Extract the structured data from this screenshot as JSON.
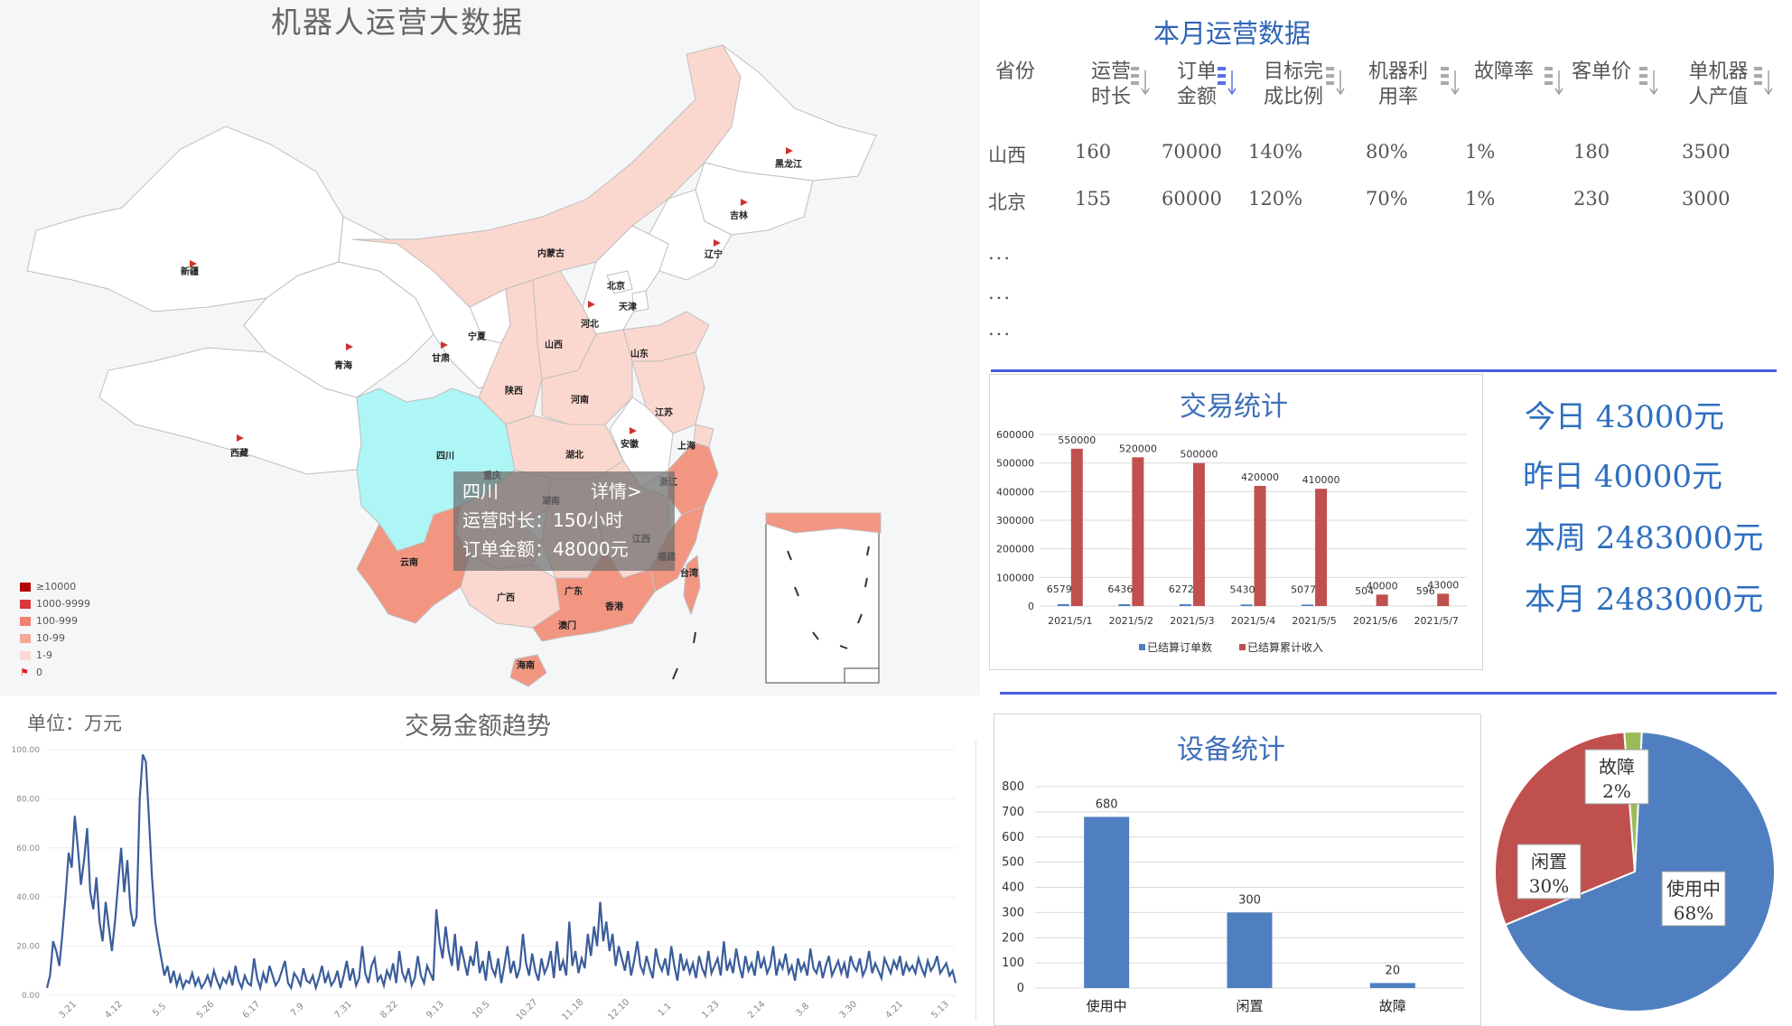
{
  "map": {
    "title": "机器人运营大数据",
    "provinces": [
      "黑龙江",
      "吉林",
      "辽宁",
      "内蒙古",
      "北京",
      "天津",
      "河北",
      "山西",
      "宁夏",
      "甘肃",
      "青海",
      "新疆",
      "西藏",
      "四川",
      "陕西",
      "河南",
      "山东",
      "江苏",
      "安徽",
      "湖北",
      "上海",
      "浙江",
      "重庆",
      "湖南",
      "江西",
      "福建",
      "云南",
      "广西",
      "广东",
      "香港",
      "澳门",
      "海南",
      "台湾"
    ],
    "tooltip": {
      "name": "四川",
      "detail": "详情>",
      "line1": "运营时长：150小时",
      "line2": "订单金额：48000元"
    },
    "legend": [
      {
        "label": "≥10000",
        "color": "#b00000"
      },
      {
        "label": "1000-9999",
        "color": "#d9363e"
      },
      {
        "label": "100-999",
        "color": "#f08070"
      },
      {
        "label": "10-99",
        "color": "#f4a898"
      },
      {
        "label": "1-9",
        "color": "#fbd9d2"
      },
      {
        "label": "0",
        "color": "#e02020"
      }
    ],
    "colors": {
      "sichuan": "#aef5f5",
      "dark": "#f29682",
      "mid": "#f6b8aa",
      "light": "#fbd8cf",
      "white": "#ffffff"
    }
  },
  "ops_table": {
    "title": "本月运营数据",
    "headers": [
      {
        "line1": "省份",
        "line2": ""
      },
      {
        "line1": "运营",
        "line2": "时长"
      },
      {
        "line1": "订单",
        "line2": "金额"
      },
      {
        "line1": "目标完",
        "line2": "成比例"
      },
      {
        "line1": "机器利",
        "line2": "用率"
      },
      {
        "line1": "故障率",
        "line2": ""
      },
      {
        "line1": "客单价",
        "line2": ""
      },
      {
        "line1": "单机器",
        "line2": "人产值"
      }
    ],
    "rows": [
      [
        "山西",
        "160",
        "70000",
        "140%",
        "80%",
        "1%",
        "180",
        "3500"
      ],
      [
        "北京",
        "155",
        "60000",
        "120%",
        "70%",
        "1%",
        "230",
        "3000"
      ]
    ],
    "ellipsis": [
      "...",
      "...",
      "..."
    ]
  },
  "trade_stats": {
    "title": "交易统计",
    "today": "今日 43000元",
    "yesterday": "昨日 40000元",
    "week": "本周 2483000元",
    "month": "本月 2483000元"
  },
  "device_stats": {
    "title": "设备统计"
  },
  "trend": {
    "title": "交易金额趋势",
    "unit": "单位：万元"
  },
  "chart_data": [
    {
      "type": "bar",
      "title": "交易统计",
      "categories": [
        "2021/5/1",
        "2021/5/2",
        "2021/5/3",
        "2021/5/4",
        "2021/5/5",
        "2021/5/6",
        "2021/5/7"
      ],
      "series": [
        {
          "name": "已结算订单数",
          "values": [
            6579,
            6436,
            6272,
            5430,
            5077,
            504,
            596
          ],
          "color": "#4f7fc0"
        },
        {
          "name": "已结算累计收入",
          "values": [
            550000,
            520000,
            500000,
            420000,
            410000,
            40000,
            43000
          ],
          "color": "#c0504d"
        }
      ],
      "ylim": [
        0,
        600000
      ],
      "yticks": [
        0,
        100000,
        200000,
        300000,
        400000,
        500000,
        600000
      ],
      "legend": "bottom"
    },
    {
      "type": "bar",
      "title": "设备统计",
      "categories": [
        "使用中",
        "闲置",
        "故障"
      ],
      "values": [
        680,
        300,
        20
      ],
      "ylim": [
        0,
        800
      ],
      "yticks": [
        0,
        100,
        200,
        300,
        400,
        500,
        600,
        700,
        800
      ],
      "color": "#4f7fc0"
    },
    {
      "type": "pie",
      "categories": [
        "使用中",
        "闲置",
        "故障"
      ],
      "values": [
        68,
        30,
        2
      ],
      "labels": [
        "68%",
        "30%",
        "2%"
      ],
      "colors": [
        "#4f7fc0",
        "#c0504d",
        "#9bbb59"
      ]
    },
    {
      "type": "line",
      "title": "交易金额趋势",
      "ylabel": "单位：万元",
      "ylim": [
        0,
        100
      ],
      "yticks": [
        0,
        20,
        40,
        60,
        80,
        100
      ],
      "xticks": [
        "3.21",
        "4.12",
        "5.5",
        "5.26",
        "6.17",
        "7.9",
        "7.31",
        "8.22",
        "9.13",
        "10.5",
        "10.27",
        "11.18",
        "12.10",
        "1.1",
        "1.23",
        "2.14",
        "3.8",
        "3.30",
        "4.21",
        "5.13"
      ],
      "color": "#3a5d9a",
      "values": [
        3,
        8,
        22,
        18,
        12,
        25,
        40,
        58,
        52,
        73,
        60,
        45,
        55,
        68,
        42,
        35,
        48,
        30,
        22,
        38,
        28,
        18,
        30,
        45,
        60,
        42,
        55,
        35,
        28,
        32,
        80,
        98,
        95,
        72,
        48,
        30,
        22,
        15,
        8,
        12,
        5,
        10,
        4,
        8,
        3,
        6,
        5,
        9,
        4,
        7,
        3,
        5,
        8,
        4,
        10,
        6,
        3,
        7,
        5,
        9,
        4,
        12,
        6,
        3,
        8,
        5,
        4,
        15,
        7,
        3,
        9,
        5,
        12,
        8,
        4,
        6,
        10,
        14,
        5,
        3,
        9,
        7,
        4,
        11,
        6,
        5,
        8,
        3,
        7,
        12,
        5,
        9,
        4,
        6,
        10,
        3,
        8,
        14,
        6,
        11,
        4,
        7,
        20,
        9,
        5,
        12,
        15,
        6,
        8,
        4,
        10,
        7,
        13,
        5,
        18,
        9,
        6,
        11,
        4,
        7,
        16,
        8,
        5,
        12,
        9,
        6,
        35,
        22,
        15,
        28,
        18,
        12,
        25,
        10,
        20,
        14,
        8,
        16,
        12,
        22,
        9,
        14,
        6,
        18,
        11,
        8,
        15,
        5,
        12,
        20,
        9,
        14,
        7,
        11,
        25,
        13,
        8,
        17,
        10,
        6,
        15,
        9,
        12,
        18,
        7,
        22,
        10,
        14,
        8,
        30,
        12,
        18,
        9,
        15,
        11,
        25,
        16,
        28,
        20,
        38,
        22,
        30,
        18,
        25,
        12,
        20,
        15,
        10,
        18,
        8,
        14,
        22,
        12,
        9,
        16,
        11,
        7,
        19,
        13,
        10,
        15,
        8,
        20,
        12,
        6,
        17,
        10,
        14,
        9,
        13,
        7,
        16,
        11,
        8,
        18,
        9,
        12,
        15,
        8,
        22,
        10,
        14,
        9,
        19,
        12,
        7,
        16,
        10,
        13,
        8,
        18,
        11,
        15,
        9,
        12,
        20,
        8,
        14,
        11,
        17,
        9,
        12,
        6,
        15,
        10,
        13,
        8,
        19,
        11,
        9,
        14,
        7,
        12,
        16,
        8,
        11,
        14,
        9,
        13,
        7,
        16,
        12,
        10,
        15,
        8,
        11,
        18,
        9,
        13,
        10,
        7,
        15,
        12,
        9,
        14,
        11,
        16,
        8,
        13,
        10,
        12,
        9,
        15,
        11,
        8,
        14,
        10,
        12,
        16,
        9,
        11,
        13,
        8,
        10,
        5
      ]
    }
  ]
}
